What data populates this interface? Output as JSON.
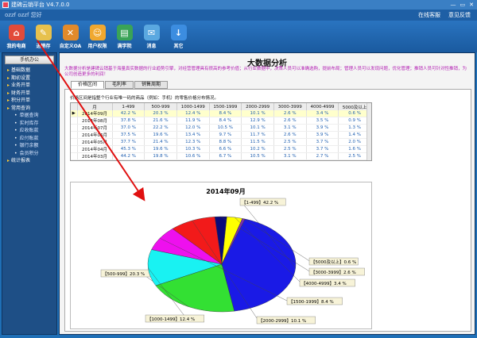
{
  "window": {
    "title": "建碑云销平台 V4.7.0.0",
    "controls": [
      "—",
      "▭",
      "✕"
    ]
  },
  "userbar": {
    "user": "ozzf ozzf 您好",
    "online_service": "在线客服",
    "feedback": "意见反馈"
  },
  "toolbar": [
    {
      "label": "我的电商",
      "icon": "house-icon",
      "color": "#e24b3a"
    },
    {
      "label": "进销存",
      "icon": "notebook-icon",
      "color": "#e7c14d"
    },
    {
      "label": "自定义OA",
      "icon": "tools-icon",
      "color": "#e28a2b"
    },
    {
      "label": "用户权限",
      "icon": "users-icon",
      "color": "#f0a830"
    },
    {
      "label": "满学院",
      "icon": "book-icon",
      "color": "#3aa357"
    },
    {
      "label": "消息",
      "icon": "chat-icon",
      "color": "#5aa8e0"
    },
    {
      "label": "其它",
      "icon": "download-icon",
      "color": "#3c8de0"
    }
  ],
  "sidebar": {
    "header": "手机办公",
    "items": [
      {
        "label": "基础数据",
        "type": "grp"
      },
      {
        "label": "期初设置",
        "type": "grp"
      },
      {
        "label": "业务开单",
        "type": "grp"
      },
      {
        "label": "财务开单",
        "type": "grp"
      },
      {
        "label": "积分开单",
        "type": "grp"
      },
      {
        "label": "常用查询",
        "type": "grp"
      },
      {
        "label": "单据查询",
        "type": "sub"
      },
      {
        "label": "实时库存",
        "type": "sub"
      },
      {
        "label": "应收账款",
        "type": "sub"
      },
      {
        "label": "应付账款",
        "type": "sub"
      },
      {
        "label": "银行余额",
        "type": "sub"
      },
      {
        "label": "会员积分",
        "type": "sub"
      },
      {
        "label": "统计报表",
        "type": "grp"
      }
    ]
  },
  "main": {
    "title": "大数据分析",
    "description": "大数据分析是建碑云销基于海量真实数据的行业趋势引擎，对经营管理具有很高的参考价值；从行业数据中，决策人员可以准确选购，提前布局；管理人员可以发现问题，优化管理；推销人员可针对性推销，为公司创造更多的利润！",
    "tabs": [
      "价格区间",
      "毛利率",
      "销售周期"
    ],
    "note": "价格区间是指整个行业有唯一码的商品（例如：手机）的零售价格分布情况。"
  },
  "table": {
    "headers": [
      "月",
      "1-499",
      "500-999",
      "1000-1499",
      "1500-1999",
      "2000-2999",
      "3000-3999",
      "4000-4999",
      "5000及以上"
    ],
    "rows": [
      [
        "2014年09月",
        "42.2 %",
        "20.3 %",
        "12.4 %",
        "8.4 %",
        "10.1 %",
        "2.6 %",
        "3.4 %",
        "0.6 %"
      ],
      [
        "2014年08月",
        "37.8 %",
        "21.6 %",
        "11.9 %",
        "8.4 %",
        "12.9 %",
        "2.6 %",
        "3.5 %",
        "0.9 %"
      ],
      [
        "2014年07月",
        "37.0 %",
        "22.2 %",
        "12.0 %",
        "10.5 %",
        "10.1 %",
        "3.1 %",
        "3.9 %",
        "1.3 %"
      ],
      [
        "2014年06月",
        "37.5 %",
        "19.6 %",
        "13.4 %",
        "9.7 %",
        "11.7 %",
        "2.6 %",
        "3.9 %",
        "1.4 %"
      ],
      [
        "2014年05月",
        "37.7 %",
        "21.4 %",
        "12.3 %",
        "8.8 %",
        "11.5 %",
        "2.5 %",
        "3.7 %",
        "2.0 %"
      ],
      [
        "2014年04月",
        "45.3 %",
        "19.6 %",
        "10.3 %",
        "6.6 %",
        "10.2 %",
        "2.5 %",
        "3.7 %",
        "1.6 %"
      ],
      [
        "2014年03月",
        "44.2 %",
        "19.8 %",
        "10.6 %",
        "6.7 %",
        "10.5 %",
        "3.1 %",
        "2.7 %",
        "2.5 %"
      ]
    ]
  },
  "chart_data": {
    "type": "pie",
    "title": "2014年09月",
    "slices": [
      {
        "label": "【1-499】42.2 %",
        "value": 42.2,
        "color": "#1a1ae6"
      },
      {
        "label": "【500-999】20.3 %",
        "value": 20.3,
        "color": "#33e033"
      },
      {
        "label": "【1000-1499】12.4 %",
        "value": 12.4,
        "color": "#19f2f2"
      },
      {
        "label": "【1500-1999】8.4 %",
        "value": 8.4,
        "color": "#ee10ee"
      },
      {
        "label": "【2000-2999】10.1 %",
        "value": 10.1,
        "color": "#f21a1a"
      },
      {
        "label": "【3000-3999】2.6 %",
        "value": 2.6,
        "color": "#0a0a7a"
      },
      {
        "label": "【4000-4999】3.4 %",
        "value": 3.4,
        "color": "#ffff00"
      },
      {
        "label": "【5000及以上】0.6 %",
        "value": 0.6,
        "color": "#7b2fb0"
      }
    ]
  }
}
